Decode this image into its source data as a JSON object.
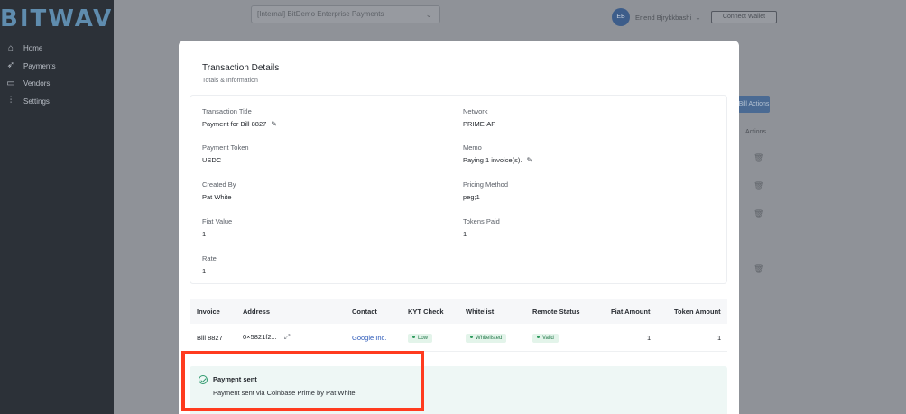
{
  "app": {
    "logo": "BITWAVE",
    "nav": [
      {
        "label": "Home",
        "icon": "home-icon"
      },
      {
        "label": "Payments",
        "icon": "rocket-icon"
      },
      {
        "label": "Vendors",
        "icon": "inbox-icon"
      },
      {
        "label": "Settings",
        "icon": "sliders-icon"
      }
    ],
    "org_select": "[Internal] BitDemo Enterprise Payments",
    "user": {
      "initials": "EB",
      "name": "Erlend Bjrykkbashi"
    },
    "connect_wallet": "Connect Wallet",
    "bg_button": "Bill Actions",
    "bg_actions_header": "Actions"
  },
  "modal": {
    "title": "Transaction Details",
    "subtitle": "Totals & Information",
    "fields": {
      "transaction_title": {
        "label": "Transaction Title",
        "value": "Payment for Bill 8827"
      },
      "network": {
        "label": "Network",
        "value": "PRIME-AP"
      },
      "payment_token": {
        "label": "Payment Token",
        "value": "USDC"
      },
      "memo": {
        "label": "Memo",
        "value": "Paying 1 invoice(s)."
      },
      "created_by": {
        "label": "Created By",
        "value": "Pat White"
      },
      "pricing_method": {
        "label": "Pricing Method",
        "value": "peg;1"
      },
      "fiat_value": {
        "label": "Fiat Value",
        "value": "1"
      },
      "tokens_paid": {
        "label": "Tokens Paid",
        "value": "1"
      },
      "rate": {
        "label": "Rate",
        "value": "1"
      }
    },
    "table": {
      "headers": [
        "Invoice",
        "Address",
        "Contact",
        "KYT Check",
        "Whitelist",
        "Remote Status",
        "Fiat Amount",
        "Token Amount"
      ],
      "rows": [
        {
          "invoice": "Bill 8827",
          "address": "0×5821f2...",
          "contact": "Google Inc.",
          "kyt": "Low",
          "whitelist": "Whitelisted",
          "remote_status": "Valid",
          "fiat_amount": "1",
          "token_amount": "1"
        }
      ]
    },
    "status": {
      "title": "Payment sent",
      "description": "Payment sent via Coinbase Prime by Pat White."
    }
  },
  "colors": {
    "highlight": "#ff3b1f",
    "link": "#2b58b8",
    "badge_green": "#237a4b"
  }
}
